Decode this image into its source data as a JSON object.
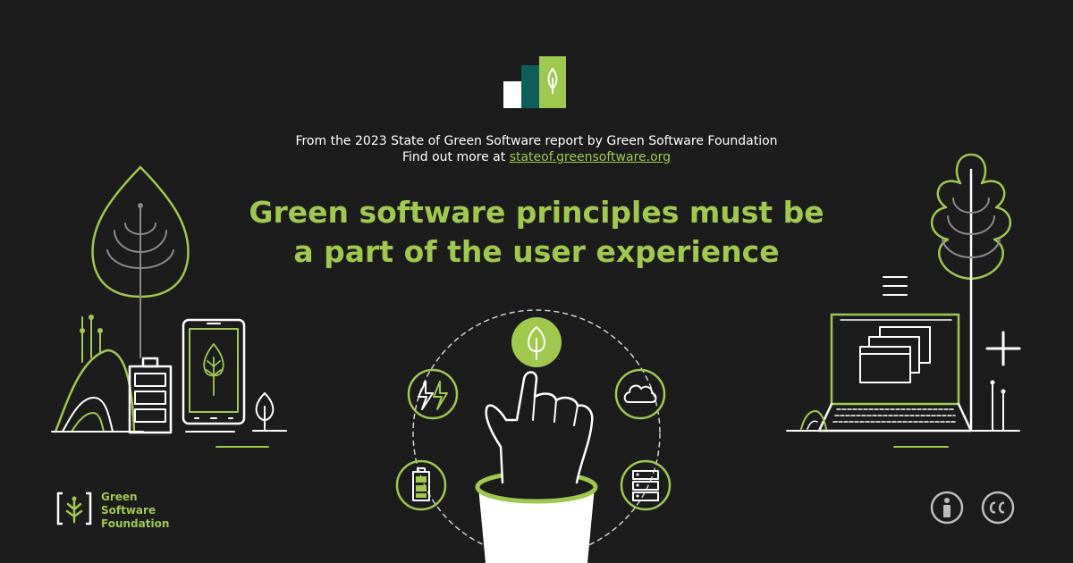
{
  "intro": {
    "line1": "From the 2023 State of Green Software report by Green Software Foundation",
    "line2_prefix": "Find out more at ",
    "link": "stateof.greensoftware.org"
  },
  "headline": {
    "line1": "Green software principles must be",
    "line2": "a part of the user experience"
  },
  "footer": {
    "org_line1": "Green",
    "org_line2": "Software",
    "org_line3": "Foundation"
  },
  "icons": [
    "report-logo-icon",
    "tree-icon",
    "battery-icon",
    "phone-icon",
    "hand-icon",
    "leaf-icon",
    "lightning-icon",
    "cloud-icon",
    "server-icon",
    "laptop-icon",
    "menu-icon",
    "plus-icon",
    "info-icon",
    "cc-icon"
  ],
  "colors": {
    "background": "#1c1c1c",
    "accent": "#9fc84f",
    "teal": "#0e5f5b",
    "white": "#ffffff"
  }
}
